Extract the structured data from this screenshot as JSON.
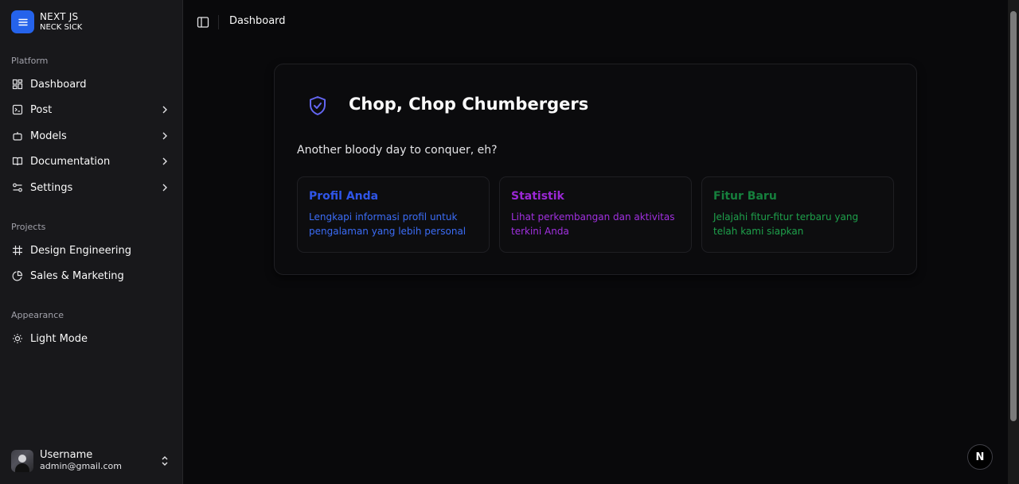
{
  "brand": {
    "title": "NEXT JS",
    "subtitle": "NECK SICK",
    "accent": "#2563eb"
  },
  "sidebar": {
    "platform_label": "Platform",
    "platform_items": [
      {
        "label": "Dashboard",
        "icon": "dashboard-icon",
        "has_chevron": false
      },
      {
        "label": "Post",
        "icon": "post-icon",
        "has_chevron": true
      },
      {
        "label": "Models",
        "icon": "bot-icon",
        "has_chevron": true
      },
      {
        "label": "Documentation",
        "icon": "book-icon",
        "has_chevron": true
      },
      {
        "label": "Settings",
        "icon": "settings-icon",
        "has_chevron": true
      }
    ],
    "projects_label": "Projects",
    "project_items": [
      {
        "label": "Design Engineering",
        "icon": "frame-icon"
      },
      {
        "label": "Sales & Marketing",
        "icon": "pie-chart-icon"
      }
    ],
    "appearance_label": "Appearance",
    "appearance_items": [
      {
        "label": "Light Mode",
        "icon": "sun-icon"
      }
    ],
    "user": {
      "name": "Username",
      "email": "admin@gmail.com"
    }
  },
  "header": {
    "breadcrumb": "Dashboard"
  },
  "main": {
    "title": "Chop, Chop Chumbergers",
    "subtitle": "Another bloody day to conquer, eh?",
    "features": [
      {
        "title": "Profil Anda",
        "desc": "Lengkapi informasi profil untuk pengalaman yang lebih personal",
        "color": "#2f55e8",
        "desc_color": "#3b6cf6"
      },
      {
        "title": "Statistik",
        "desc": "Lihat perkembangan dan aktivitas terkini Anda",
        "color": "#9b27d6",
        "desc_color": "#a130e0"
      },
      {
        "title": "Fitur Baru",
        "desc": "Jelajahi fitur-fitur terbaru yang telah kami siapkan",
        "color": "#16803d",
        "desc_color": "#1ea04b"
      }
    ]
  },
  "badge": {
    "label": "N"
  }
}
